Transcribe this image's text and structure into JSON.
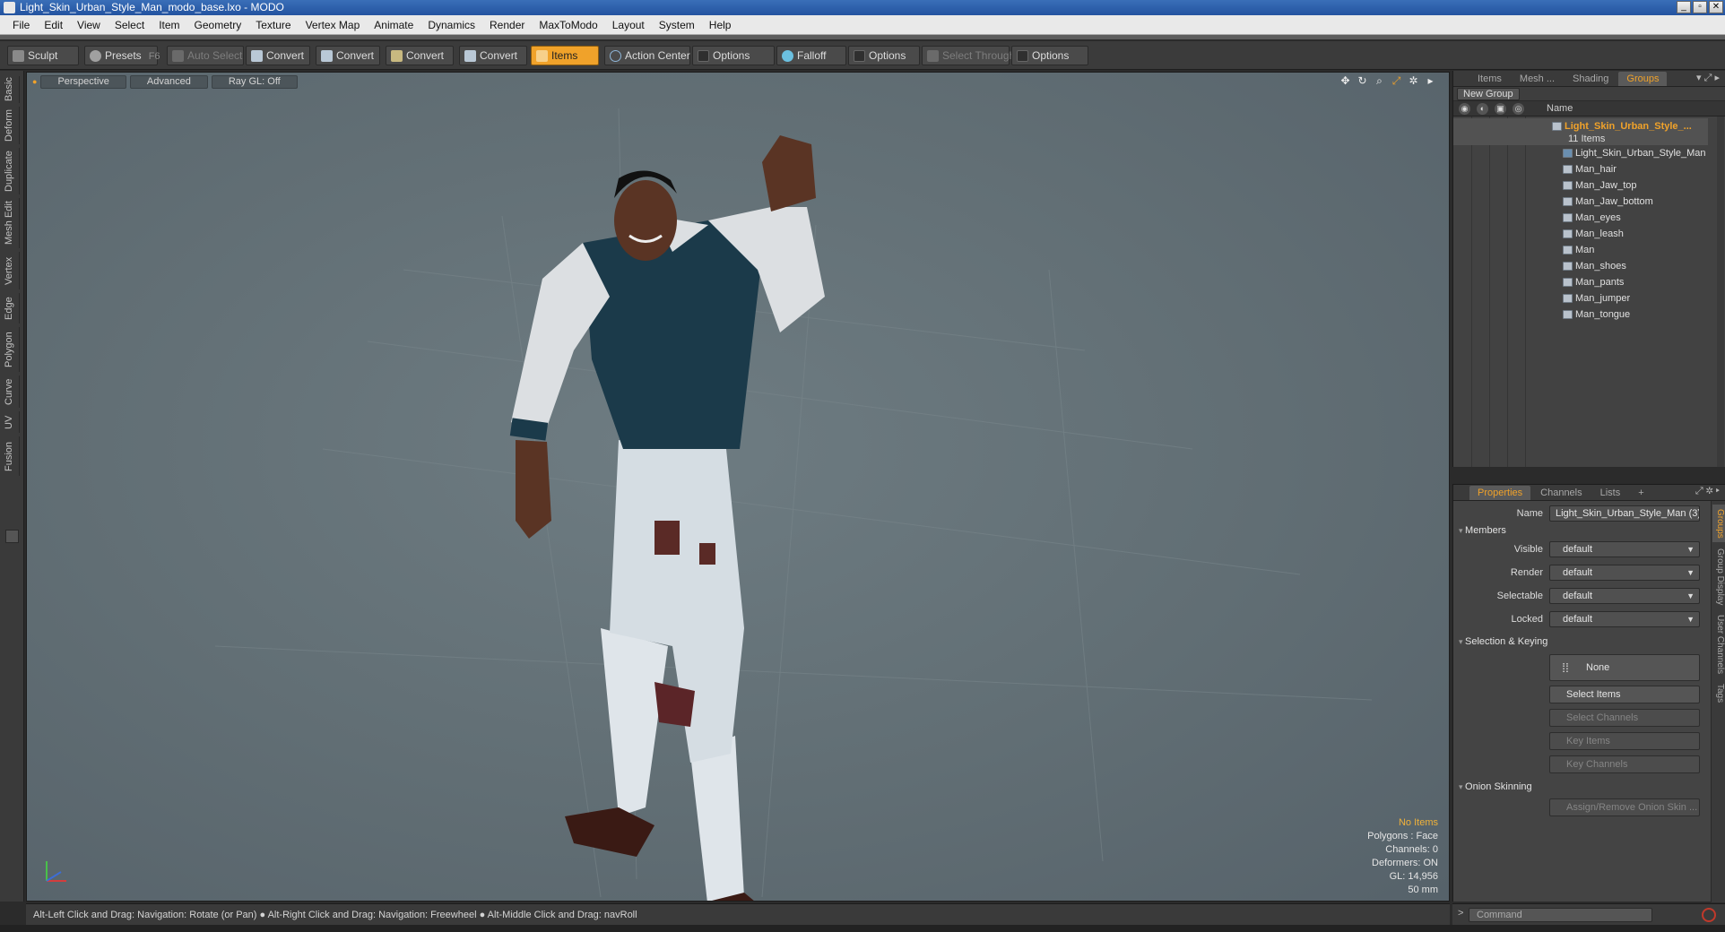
{
  "window": {
    "title": "Light_Skin_Urban_Style_Man_modo_base.lxo - MODO"
  },
  "menu": [
    "File",
    "Edit",
    "View",
    "Select",
    "Item",
    "Geometry",
    "Texture",
    "Vertex Map",
    "Animate",
    "Dynamics",
    "Render",
    "MaxToModo",
    "Layout",
    "System",
    "Help"
  ],
  "toolbar": {
    "sculpt": "Sculpt",
    "presets": "Presets",
    "presets_key": "F6",
    "auto_select": "Auto Select",
    "convert1": "Convert",
    "convert2": "Convert",
    "convert3": "Convert",
    "convert4": "Convert",
    "items": "Items",
    "action_center": "Action Center",
    "options1": "Options",
    "falloff": "Falloff",
    "options2": "Options",
    "select_through": "Select Through",
    "options3": "Options"
  },
  "left_tabs": [
    "Basic",
    "Deform",
    "Duplicate",
    "Mesh Edit",
    "Vertex",
    "Edge",
    "Polygon",
    "Curve",
    "UV",
    "Fusion"
  ],
  "viewport": {
    "tabs": [
      "Perspective",
      "Advanced",
      "Ray GL: Off"
    ],
    "info": {
      "items": "No Items",
      "polygons": "Polygons : Face",
      "channels": "Channels: 0",
      "deformers": "Deformers: ON",
      "gl": "GL: 14,956",
      "focal": "50 mm"
    }
  },
  "status": "Alt-Left Click and Drag: Navigation: Rotate (or Pan) ● Alt-Right Click and Drag: Navigation: Freewheel ● Alt-Middle Click and Drag: navRoll",
  "groups_panel": {
    "tabs": [
      "Items",
      "Mesh ...",
      "Shading",
      "Groups"
    ],
    "active_tab": "Groups",
    "new_group": "New Group",
    "name_col": "Name",
    "group_name": "Light_Skin_Urban_Style_...",
    "group_count": "11 Items",
    "items": [
      "Light_Skin_Urban_Style_Man",
      "Man_hair",
      "Man_Jaw_top",
      "Man_Jaw_bottom",
      "Man_eyes",
      "Man_leash",
      "Man",
      "Man_shoes",
      "Man_pants",
      "Man_jumper",
      "Man_tongue"
    ]
  },
  "properties": {
    "tabs": [
      "Properties",
      "Channels",
      "Lists"
    ],
    "add_tab": "+",
    "side_tabs": [
      "Groups",
      "Group Display",
      "User Channels",
      "Tags"
    ],
    "name_label": "Name",
    "name_value": "Light_Skin_Urban_Style_Man (3)",
    "members": "Members",
    "visible_label": "Visible",
    "visible": "default",
    "render_label": "Render",
    "render": "default",
    "selectable_label": "Selectable",
    "selectable": "default",
    "locked_label": "Locked",
    "locked": "default",
    "selection_keying": "Selection & Keying",
    "none": "None",
    "select_items": "Select Items",
    "select_channels": "Select Channels",
    "key_items": "Key Items",
    "key_channels": "Key Channels",
    "onion": "Onion Skinning",
    "assign_onion": "Assign/Remove Onion Skin ..."
  },
  "command": {
    "placeholder": "Command",
    "prompt": ">"
  },
  "colors": {
    "accent": "#f0a22a",
    "viewport": "#637076",
    "shirt": "#1b3a4a",
    "sleeves": "#d9dde0",
    "skin": "#5a3424"
  }
}
